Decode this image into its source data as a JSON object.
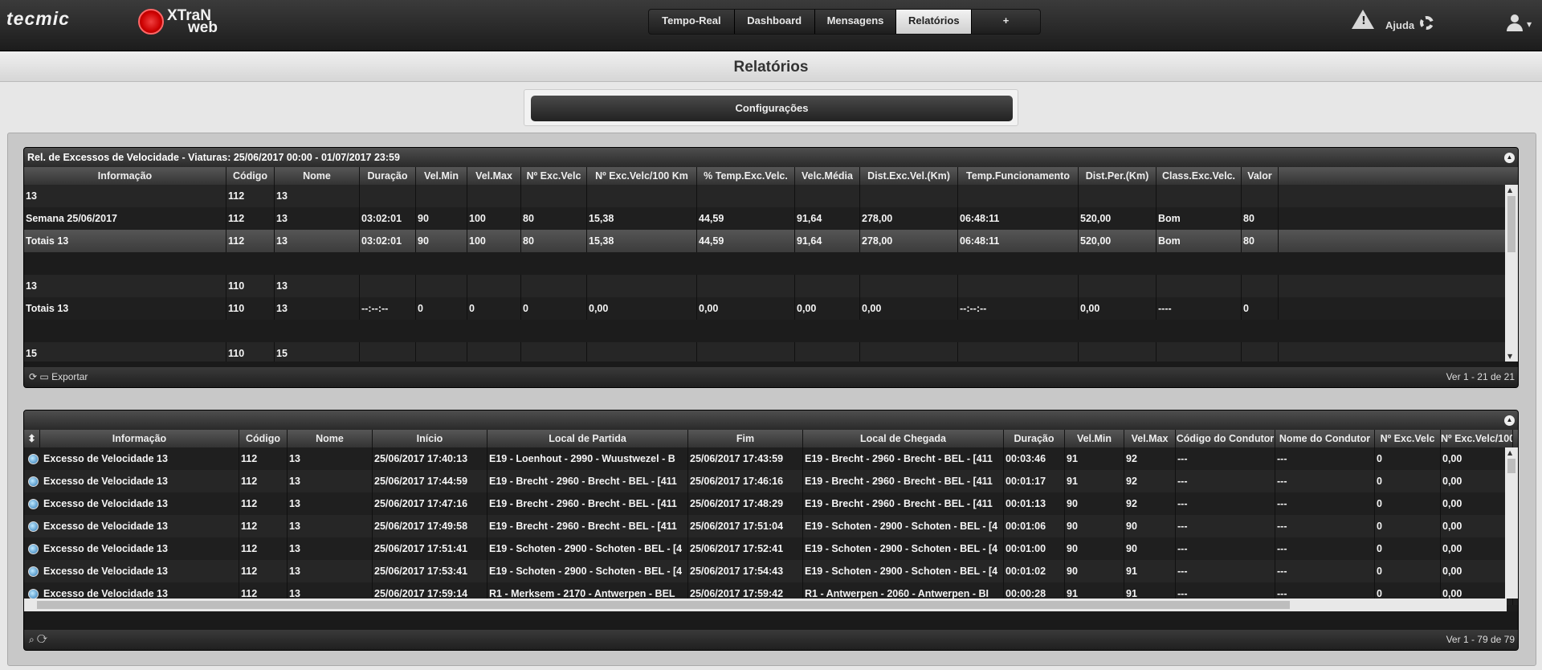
{
  "header": {
    "brand_left": "tecmic",
    "brand_right_top": "XTraN",
    "brand_right_bottom": "web",
    "nav_tabs": [
      {
        "label": "Tempo-Real",
        "active": false
      },
      {
        "label": "Dashboard",
        "active": false
      },
      {
        "label": "Mensagens",
        "active": false
      },
      {
        "label": "Relatórios",
        "active": true
      },
      {
        "label": "+",
        "active": false
      }
    ],
    "help_label": "Ajuda",
    "warning_glyph": "!"
  },
  "page": {
    "title": "Relatórios",
    "config_button": "Configurações"
  },
  "report1": {
    "title": "Rel. de Excessos de Velocidade - Viaturas: 25/06/2017 00:00 - 01/07/2017 23:59",
    "columns": [
      "Informação",
      "Código",
      "Nome",
      "Duração",
      "Vel.Min",
      "Vel.Max",
      "Nº Exc.Velc",
      "Nº Exc.Velc/100 Km",
      "% Temp.Exc.Velc.",
      "Velc.Média",
      "Dist.Exc.Vel.(Km)",
      "Temp.Funcionamento",
      "Dist.Per.(Km)",
      "Class.Exc.Velc.",
      "Valor"
    ],
    "rows": [
      {
        "type": "odd",
        "cells": [
          "13",
          "112",
          "13",
          "",
          "",
          "",
          "",
          "",
          "",
          "",
          "",
          "",
          "",
          "",
          ""
        ]
      },
      {
        "type": "even",
        "cells": [
          "Semana 25/06/2017",
          "112",
          "13",
          "03:02:01",
          "90",
          "100",
          "80",
          "15,38",
          "44,59",
          "91,64",
          "278,00",
          "06:48:11",
          "520,00",
          "Bom",
          "80"
        ]
      },
      {
        "type": "sel",
        "cells": [
          "Totais 13",
          "112",
          "13",
          "03:02:01",
          "90",
          "100",
          "80",
          "15,38",
          "44,59",
          "91,64",
          "278,00",
          "06:48:11",
          "520,00",
          "Bom",
          "80"
        ]
      },
      {
        "type": "blank",
        "cells": []
      },
      {
        "type": "odd",
        "cells": [
          "13",
          "110",
          "13",
          "",
          "",
          "",
          "",
          "",
          "",
          "",
          "",
          "",
          "",
          "",
          ""
        ]
      },
      {
        "type": "even",
        "cells": [
          "Totais 13",
          "110",
          "13",
          "--:--:--",
          "0",
          "0",
          "0",
          "0,00",
          "0,00",
          "0,00",
          "0,00",
          "--:--:--",
          "0,00",
          "----",
          "0"
        ]
      },
      {
        "type": "blank",
        "cells": []
      },
      {
        "type": "odd",
        "cells": [
          "15",
          "110",
          "15",
          "",
          "",
          "",
          "",
          "",
          "",
          "",
          "",
          "",
          "",
          "",
          ""
        ]
      }
    ],
    "footer_left": "Exportar",
    "footer_info": "Ver 1 - 21 de 21"
  },
  "report2": {
    "columns": [
      "Informação",
      "Código",
      "Nome",
      "Início",
      "Local de Partida",
      "Fim",
      "Local de Chegada",
      "Duração",
      "Vel.Min",
      "Vel.Max",
      "Código do Condutor",
      "Nome do Condutor",
      "Nº Exc.Velc",
      "Nº Exc.Velc/100"
    ],
    "rows": [
      [
        "Excesso de Velocidade 13",
        "112",
        "13",
        "25/06/2017 17:40:13",
        "E19 - Loenhout - 2990 - Wuustwezel - B",
        "25/06/2017 17:43:59",
        "E19 - Brecht - 2960 - Brecht - BEL - [411",
        "00:03:46",
        "91",
        "92",
        "---",
        "---",
        "0",
        "0,00"
      ],
      [
        "Excesso de Velocidade 13",
        "112",
        "13",
        "25/06/2017 17:44:59",
        "E19 - Brecht - 2960 - Brecht - BEL - [411",
        "25/06/2017 17:46:16",
        "E19 - Brecht - 2960 - Brecht - BEL - [411",
        "00:01:17",
        "91",
        "92",
        "---",
        "---",
        "0",
        "0,00"
      ],
      [
        "Excesso de Velocidade 13",
        "112",
        "13",
        "25/06/2017 17:47:16",
        "E19 - Brecht - 2960 - Brecht - BEL - [411",
        "25/06/2017 17:48:29",
        "E19 - Brecht - 2960 - Brecht - BEL - [411",
        "00:01:13",
        "90",
        "92",
        "---",
        "---",
        "0",
        "0,00"
      ],
      [
        "Excesso de Velocidade 13",
        "112",
        "13",
        "25/06/2017 17:49:58",
        "E19 - Brecht - 2960 - Brecht - BEL - [411",
        "25/06/2017 17:51:04",
        "E19 - Schoten - 2900 - Schoten - BEL - [4",
        "00:01:06",
        "90",
        "90",
        "---",
        "---",
        "0",
        "0,00"
      ],
      [
        "Excesso de Velocidade 13",
        "112",
        "13",
        "25/06/2017 17:51:41",
        "E19 - Schoten - 2900 - Schoten - BEL - [4",
        "25/06/2017 17:52:41",
        "E19 - Schoten - 2900 - Schoten - BEL - [4",
        "00:01:00",
        "90",
        "90",
        "---",
        "---",
        "0",
        "0,00"
      ],
      [
        "Excesso de Velocidade 13",
        "112",
        "13",
        "25/06/2017 17:53:41",
        "E19 - Schoten - 2900 - Schoten - BEL - [4",
        "25/06/2017 17:54:43",
        "E19 - Schoten - 2900 - Schoten - BEL - [4",
        "00:01:02",
        "90",
        "91",
        "---",
        "---",
        "0",
        "0,00"
      ],
      [
        "Excesso de Velocidade 13",
        "112",
        "13",
        "25/06/2017 17:59:14",
        "R1 - Merksem - 2170 - Antwerpen - BEL",
        "25/06/2017 17:59:42",
        "R1 - Antwerpen - 2060 - Antwerpen - BI",
        "00:00:28",
        "91",
        "91",
        "---",
        "---",
        "0",
        "0,00"
      ]
    ],
    "footer_info": "Ver 1 - 79 de 79"
  }
}
